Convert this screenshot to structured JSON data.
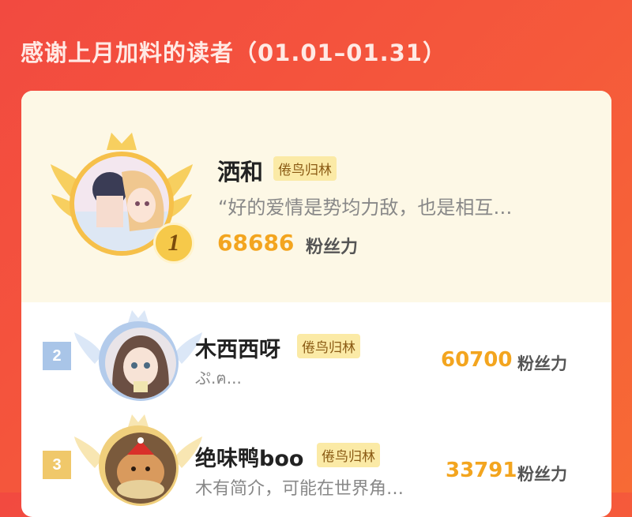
{
  "header": {
    "title": "感谢上月加料的读者（01.01–01.31）"
  },
  "leaders": [
    {
      "rank": "1",
      "name": "洒和",
      "tag": "倦鸟归林",
      "bio": "“好的爱情是势均力敌，也是相互…",
      "score": "68686",
      "unit": "粉丝力"
    },
    {
      "rank": "2",
      "name": "木西西呀",
      "tag": "倦鸟归林",
      "bio": "ぷ.ฅ...",
      "score": "60700",
      "unit": "粉丝力"
    },
    {
      "rank": "3",
      "name": "绝味鸭boo",
      "tag": "倦鸟归林",
      "bio": "木有简介，可能在世界角…",
      "score": "33791",
      "unit": "粉丝力"
    }
  ],
  "colors": {
    "accent": "#f24a40",
    "score": "#f3a51f",
    "tag_bg": "#fbeaa6",
    "rank2": "#a9c5e8",
    "rank3": "#f0c86a"
  }
}
